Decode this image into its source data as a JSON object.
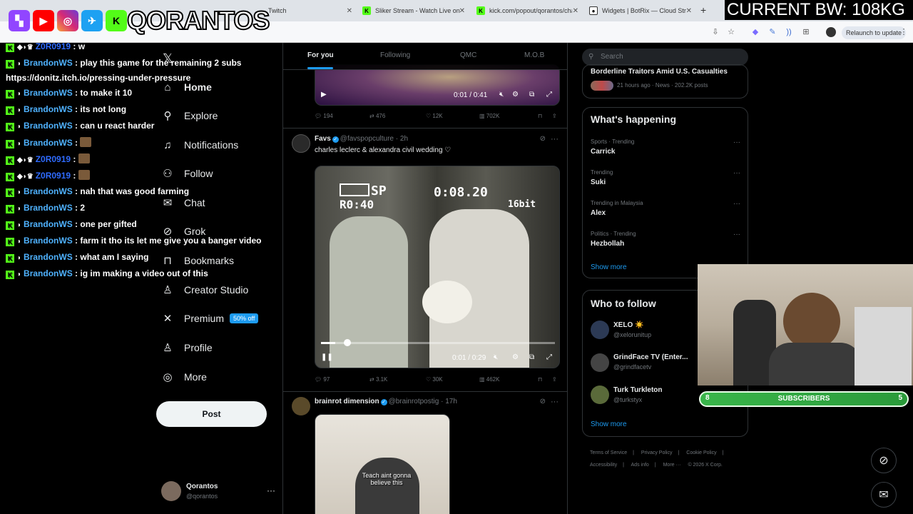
{
  "browser": {
    "tabs": [
      {
        "title": "Twitch",
        "icon": "twitch-icon",
        "fav_color": "#9146ff"
      },
      {
        "title": "Sliker Stream - Watch Live on K",
        "icon": "kick-icon",
        "fav_color": "#53fc18"
      },
      {
        "title": "kick.com/popout/qorantos/cha",
        "icon": "kick-icon",
        "fav_color": "#53fc18"
      },
      {
        "title": "Widgets | BotRix — Cloud Strea",
        "icon": "github-icon",
        "fav_color": "#ffffff"
      }
    ],
    "new_tab": "+",
    "relaunch_label": "Relaunch to update"
  },
  "stream": {
    "logo_text": "QORANTOS",
    "bandwidth_text": "CURRENT BW: 108KG",
    "subs_goal": {
      "current": "8",
      "label": "SUBSCRIBERS",
      "target": "5"
    }
  },
  "chat": {
    "wrap_text": "https://donitz.itch.io/pressing-under-pressure",
    "lines": [
      {
        "user": "Z0R0919",
        "text": "w",
        "type": "z",
        "emote": false
      },
      {
        "user": "BrandonWS",
        "text": "play this game for the remaining 2 subs",
        "type": "b",
        "emote": false
      },
      {
        "user": "BrandonWS",
        "text": "to make it 10",
        "type": "b",
        "emote": false
      },
      {
        "user": "BrandonWS",
        "text": "its not long",
        "type": "b",
        "emote": false
      },
      {
        "user": "BrandonWS",
        "text": "can u react harder",
        "type": "b",
        "emote": false
      },
      {
        "user": "BrandonWS",
        "text": "",
        "type": "b",
        "emote": true
      },
      {
        "user": "Z0R0919",
        "text": "",
        "type": "z",
        "emote": true
      },
      {
        "user": "Z0R0919",
        "text": "",
        "type": "z",
        "emote": true
      },
      {
        "user": "BrandonWS",
        "text": "nah that was good farming",
        "type": "b",
        "emote": false
      },
      {
        "user": "BrandonWS",
        "text": "2",
        "type": "b",
        "emote": false
      },
      {
        "user": "BrandonWS",
        "text": "one per gifted",
        "type": "b",
        "emote": false
      },
      {
        "user": "BrandonWS",
        "text": "farm it tho its let me give you a banger video",
        "type": "b",
        "emote": false
      },
      {
        "user": "BrandonWS",
        "text": "what am I saying",
        "type": "b",
        "emote": false
      },
      {
        "user": "BrandonWS",
        "text": "ig im making a video out of this",
        "type": "b",
        "emote": false
      }
    ]
  },
  "nav": {
    "items": [
      {
        "label": "Home",
        "icon": "home-icon",
        "glyph": "⌂"
      },
      {
        "label": "Explore",
        "icon": "search-icon",
        "glyph": "⚲"
      },
      {
        "label": "Notifications",
        "icon": "bell-icon",
        "glyph": "♪"
      },
      {
        "label": "Follow",
        "icon": "add-person-icon",
        "glyph": "⚇"
      },
      {
        "label": "Chat",
        "icon": "mail-icon",
        "glyph": "✉"
      },
      {
        "label": "Grok",
        "icon": "grok-icon",
        "glyph": "⊘"
      },
      {
        "label": "Bookmarks",
        "icon": "bookmark-icon",
        "glyph": "⊓"
      },
      {
        "label": "Creator Studio",
        "icon": "lightning-icon",
        "glyph": "♙"
      },
      {
        "label": "Premium",
        "icon": "x-logo-icon",
        "glyph": "✕"
      },
      {
        "label": "Profile",
        "icon": "person-icon",
        "glyph": "♙"
      },
      {
        "label": "More",
        "icon": "more-circle-icon",
        "glyph": "◎"
      }
    ],
    "premium_badge": "50% off",
    "post_label": "Post",
    "account": {
      "name": "Qorantos",
      "handle": "@qorantos",
      "more": "···"
    }
  },
  "feed": {
    "tabs": [
      "For you",
      "Following",
      "QMC",
      "M.O.B"
    ],
    "tweets": [
      {
        "video_time": "0:01 / 0:41",
        "stats": {
          "replies": "194",
          "reposts": "476",
          "likes": "12K",
          "views": "702K"
        }
      },
      {
        "name": "Favs",
        "handle": "@favspopculture",
        "time": "· 2h",
        "text": "charles leclerc & alexandra civil wedding ♡",
        "overlay_sp": "SP",
        "overlay_ro": "R0:40",
        "overlay_timecode": "0:08.20",
        "overlay_bit": "16bit",
        "video_time": "0:01 / 0:29",
        "progress": 0.06,
        "stats": {
          "replies": "97",
          "reposts": "3.1K",
          "likes": "30K",
          "views": "462K"
        }
      },
      {
        "name": "brainrot dimension",
        "handle": "@brainrotpostig",
        "time": "· 17h",
        "caption": "Teach aint gonna believe this"
      }
    ]
  },
  "right": {
    "search_placeholder": "Search",
    "top_story": {
      "title": "Borderline Traitors Amid U.S. Casualties",
      "meta": "21 hours ago · News · 202.2K posts"
    },
    "happening_title": "What's happening",
    "trends": [
      {
        "meta": "Sports · Trending",
        "name": "Carrick"
      },
      {
        "meta": "Trending",
        "name": "Suki"
      },
      {
        "meta": "Trending in Malaysia",
        "name": "Alex"
      },
      {
        "meta": "Politics · Trending",
        "name": "Hezbollah"
      }
    ],
    "show_more": "Show more",
    "who_title": "Who to follow",
    "follow": [
      {
        "name": "XELO ☀️",
        "handle": "@xelorunitup",
        "color": "#2c3a55"
      },
      {
        "name": "GrindFace TV (Enter...",
        "handle": "@grindfacetv",
        "color": "#444444"
      },
      {
        "name": "Turk Turkleton",
        "handle": "@turkstyx",
        "color": "#5a6a3a"
      }
    ],
    "footer": [
      "Terms of Service",
      "|",
      "Privacy Policy",
      "|",
      "Cookie Policy",
      "|",
      "Accessibility",
      "|",
      "Ads info",
      "|",
      "More ···",
      "© 2026 X Corp."
    ]
  },
  "colors": {
    "accent": "#1d9bf0",
    "kick": "#53fc18",
    "twitch": "#9146ff"
  }
}
